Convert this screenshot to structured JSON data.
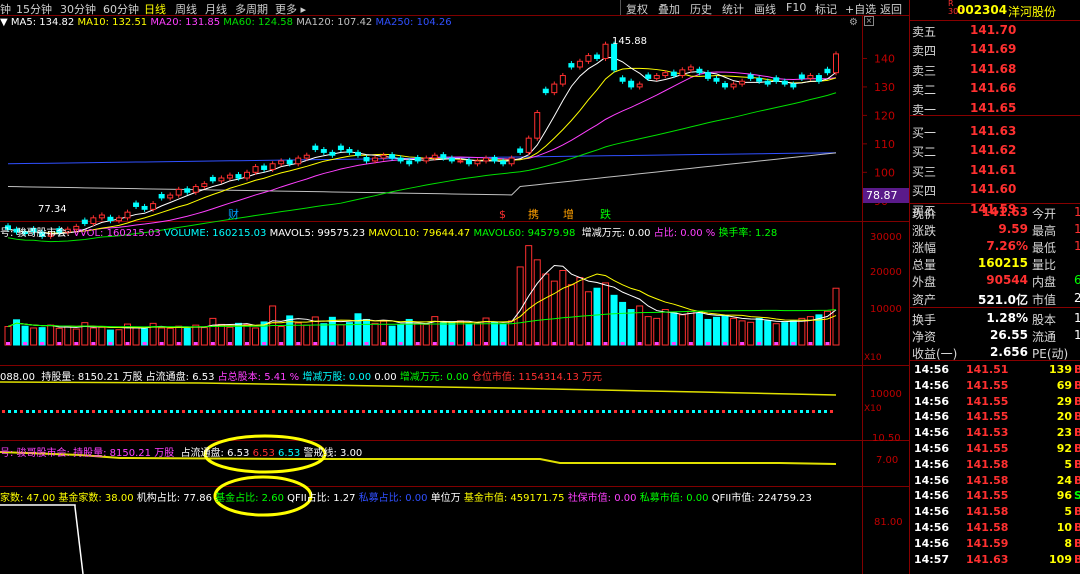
{
  "toolbar": {
    "left_items": [
      "钟",
      "15分钟",
      "30分钟",
      "60分钟",
      "日线",
      "周线",
      "月线",
      "多周期",
      "更多 ▸"
    ],
    "right_items": [
      "复权",
      "叠加",
      "历史",
      "统计",
      "画线",
      "F10",
      "标记",
      "+自选",
      "返回"
    ]
  },
  "ma_line": [
    {
      "text": "MA5: 134.82",
      "color": "#ffffff"
    },
    {
      "text": "MA10: 132.51",
      "color": "#ffff00"
    },
    {
      "text": "MA20: 131.85",
      "color": "#ff40ff"
    },
    {
      "text": "MA60: 124.58",
      "color": "#00e000"
    },
    {
      "text": "MA120: 107.42",
      "color": "#c0c0c0"
    },
    {
      "text": "MA250: 104.26",
      "color": "#3050ff"
    }
  ],
  "chart_data": [
    {
      "type": "candlestick",
      "title": "",
      "y_ticks": [
        90.0,
        100.0,
        110.0,
        120.0,
        130.0,
        140.0
      ],
      "ylim": [
        85,
        150
      ],
      "annotations": {
        "high": "145.88",
        "low": "77.34",
        "price_tag": "78.87"
      },
      "event_labels": [
        {
          "text": "财",
          "color": "#00a0ff"
        },
        {
          "text": "$",
          "color": "#ff3030"
        },
        {
          "text": "携",
          "color": "#ffa000"
        },
        {
          "text": "增",
          "color": "#ffa000"
        },
        {
          "text": "跌",
          "color": "#00ff00"
        }
      ],
      "closes": [
        80,
        79,
        78.5,
        79,
        77.5,
        78,
        79,
        80,
        81,
        82,
        84,
        85,
        83,
        84,
        86,
        88,
        87,
        89,
        91,
        92,
        94,
        93,
        95,
        96,
        97,
        98,
        99,
        98,
        100,
        102,
        101,
        103,
        104,
        103,
        105,
        106,
        108,
        107,
        106,
        108,
        107,
        106,
        104,
        105,
        106,
        105,
        104,
        103,
        104,
        105,
        106,
        105,
        104,
        104,
        103,
        104,
        105,
        104,
        103,
        105,
        107,
        112,
        121,
        128,
        131,
        134,
        137,
        139,
        141,
        140,
        145,
        136,
        132,
        130,
        131,
        133,
        134,
        135,
        134,
        136,
        137,
        135,
        133,
        132,
        130,
        131,
        132,
        133,
        132,
        131,
        132,
        131,
        130,
        133,
        134,
        132,
        135,
        141.6
      ]
    },
    {
      "type": "bar",
      "title": "",
      "header": [
        "号: 骏哥股市会: ",
        "VVOL: 160215.03",
        "VOLUME: 160215.03",
        "MAVOL5: 99575.23",
        "MAVOL10: 79644.47",
        "MAVOL60: 94579.98",
        "增减万元: 0.00",
        "占比: 0.00 %",
        "换手率: 1.28"
      ],
      "y_ticks": [
        "10000",
        "20000",
        "30000"
      ],
      "unit_tag": "X10",
      "values": [
        5200,
        7100,
        5300,
        4800,
        4900,
        5600,
        4700,
        5100,
        4500,
        6300,
        4800,
        5000,
        4200,
        4300,
        5900,
        4800,
        4600,
        6100,
        4800,
        4700,
        5300,
        4700,
        5600,
        4900,
        7500,
        5800,
        5000,
        6100,
        5800,
        4800,
        6500,
        11000,
        5200,
        8200,
        6200,
        5600,
        7900,
        6000,
        7800,
        5700,
        6300,
        8800,
        7200,
        6100,
        6700,
        5300,
        5800,
        7200,
        6100,
        5800,
        8000,
        6200,
        6600,
        6800,
        5800,
        6100,
        7600,
        6400,
        5900,
        6800,
        22000,
        28000,
        24000,
        20000,
        18000,
        21000,
        17000,
        19000,
        15000,
        16000,
        17500,
        14000,
        12000,
        10000,
        11000,
        8000,
        7500,
        10000,
        9000,
        8500,
        9500,
        9000,
        7200,
        7800,
        8200,
        7500,
        6800,
        6400,
        7500,
        6800,
        6000,
        6300,
        6800,
        7500,
        8000,
        8500,
        9500,
        16000
      ]
    },
    {
      "type": "line",
      "title": "",
      "header": [
        "088.00",
        "持股量: 8150.21 万股",
        "占流通盘: 6.53",
        "占总股本: 5.41 %",
        "增减万股: 0.00",
        "0.00",
        "增减万元: 0.00",
        "仓位市值: 1154314.13 万元"
      ],
      "y_ticks": [
        "10000"
      ],
      "unit_tag": "X10"
    },
    {
      "type": "line",
      "title": "",
      "header": [
        "号: 骏哥股市会: ",
        "持股量: 8150.21 万股",
        "占流通盘: 6.53",
        "6.53",
        "6.53",
        "警戒线: 3.00"
      ],
      "y_ticks": [
        "10.50",
        "7.00"
      ]
    },
    {
      "type": "line",
      "title": "",
      "header": [
        "家数: 47.00",
        "基金家数: 38.00",
        "机构占比: 77.86",
        "基金占比: 2.60",
        "QFII占比: 1.27",
        "私募占比: 0.00",
        "单位万",
        "基金市值: 459171.75",
        "社保市值: 0.00",
        "私募市值: 0.00",
        "QFII市值: 224759.23"
      ],
      "y_ticks": [
        "81.00"
      ]
    }
  ],
  "stock": {
    "code_prefix": "R\n300",
    "code": "002304",
    "name": "洋河股份"
  },
  "order_book": [
    {
      "label": "卖五",
      "price": "141.70"
    },
    {
      "label": "卖四",
      "price": "141.69"
    },
    {
      "label": "卖三",
      "price": "141.68"
    },
    {
      "label": "卖二",
      "price": "141.66"
    },
    {
      "label": "卖一",
      "price": "141.65"
    },
    {
      "label": "买一",
      "price": "141.63"
    },
    {
      "label": "买二",
      "price": "141.62"
    },
    {
      "label": "买三",
      "price": "141.61"
    },
    {
      "label": "买四",
      "price": "141.60"
    },
    {
      "label": "买五",
      "price": "141.59"
    }
  ],
  "quote": [
    {
      "l1": "现价",
      "v1": "141.63",
      "c1": "#ff3030",
      "l2": "今开",
      "v2": "1",
      "c2": "#ff3030"
    },
    {
      "l1": "涨跌",
      "v1": "9.59",
      "c1": "#ff3030",
      "l2": "最高",
      "v2": "1",
      "c2": "#ff3030"
    },
    {
      "l1": "涨幅",
      "v1": "7.26%",
      "c1": "#ff3030",
      "l2": "最低",
      "v2": "1",
      "c2": "#ff3030"
    },
    {
      "l1": "总量",
      "v1": "160215",
      "c1": "#ffff00",
      "l2": "量比",
      "v2": "",
      "c2": "#ffff00"
    },
    {
      "l1": "外盘",
      "v1": "90544",
      "c1": "#ff3030",
      "l2": "内盘",
      "v2": "6",
      "c2": "#00ff00"
    },
    {
      "l1": "资产",
      "v1": "521.0亿",
      "c1": "#ffffff",
      "l2": "市值",
      "v2": "21",
      "c2": "#ffffff"
    },
    {
      "l1": "换手",
      "v1": "1.28%",
      "c1": "#ffffff",
      "l2": "股本",
      "v2": "1",
      "c2": "#ffffff"
    },
    {
      "l1": "净资",
      "v1": "26.55",
      "c1": "#ffffff",
      "l2": "流通",
      "v2": "1",
      "c2": "#ffffff"
    },
    {
      "l1": "收益(一)",
      "v1": "2.656",
      "c1": "#ffffff",
      "l2": "PE(动)",
      "v2": "",
      "c2": "#ffffff"
    }
  ],
  "ticks": [
    {
      "time": "14:56",
      "price": "141.51",
      "vol": "139",
      "flag": "B",
      "pc": "#ff3030",
      "vc": "#ffff00",
      "fc": "#ff3030"
    },
    {
      "time": "14:56",
      "price": "141.55",
      "vol": "69",
      "flag": "B",
      "pc": "#ff3030",
      "vc": "#ffff00",
      "fc": "#ff3030"
    },
    {
      "time": "14:56",
      "price": "141.55",
      "vol": "29",
      "flag": "B",
      "pc": "#ff3030",
      "vc": "#ffff00",
      "fc": "#ff3030"
    },
    {
      "time": "14:56",
      "price": "141.55",
      "vol": "20",
      "flag": "B",
      "pc": "#ff3030",
      "vc": "#ffff00",
      "fc": "#ff3030"
    },
    {
      "time": "14:56",
      "price": "141.53",
      "vol": "23",
      "flag": "B",
      "pc": "#ff3030",
      "vc": "#ffff00",
      "fc": "#ff3030"
    },
    {
      "time": "14:56",
      "price": "141.55",
      "vol": "92",
      "flag": "B",
      "pc": "#ff3030",
      "vc": "#ffff00",
      "fc": "#ff3030"
    },
    {
      "time": "14:56",
      "price": "141.58",
      "vol": "5",
      "flag": "B",
      "pc": "#ff3030",
      "vc": "#ffff00",
      "fc": "#ff3030"
    },
    {
      "time": "14:56",
      "price": "141.58",
      "vol": "24",
      "flag": "B",
      "pc": "#ff3030",
      "vc": "#ffff00",
      "fc": "#ff3030"
    },
    {
      "time": "14:56",
      "price": "141.55",
      "vol": "96",
      "flag": "S",
      "pc": "#ff3030",
      "vc": "#ffff00",
      "fc": "#00ff00"
    },
    {
      "time": "14:56",
      "price": "141.58",
      "vol": "5",
      "flag": "B",
      "pc": "#ff3030",
      "vc": "#ffff00",
      "fc": "#ff3030"
    },
    {
      "time": "14:56",
      "price": "141.58",
      "vol": "10",
      "flag": "B",
      "pc": "#ff3030",
      "vc": "#ffff00",
      "fc": "#ff3030"
    },
    {
      "time": "14:56",
      "price": "141.59",
      "vol": "8",
      "flag": "B",
      "pc": "#ff3030",
      "vc": "#ffff00",
      "fc": "#ff3030"
    },
    {
      "time": "14:57",
      "price": "141.63",
      "vol": "109",
      "flag": "B",
      "pc": "#ff3030",
      "vc": "#ffff00",
      "fc": "#ff3030"
    }
  ],
  "colors": {
    "up": "#ff3030",
    "down": "#00ffff",
    "ma5": "#ffffff",
    "ma10": "#ffff00",
    "ma20": "#ff40ff",
    "ma60": "#00e000",
    "ma120": "#c0c0c0",
    "ma250": "#3050ff",
    "grid": "#800000",
    "highlight": "#ffff00"
  }
}
